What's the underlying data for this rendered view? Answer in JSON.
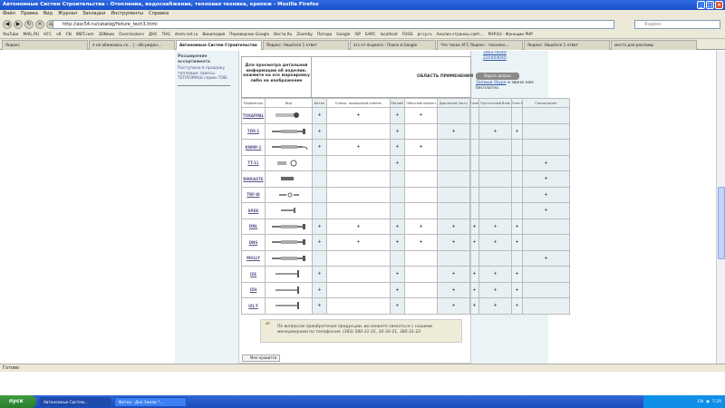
{
  "window": {
    "title": "Автономные Систем Строительства - Отопление, водоснабжение, тепловая техника, крепеж - Mozilla Firefox"
  },
  "menu": [
    "Файл",
    "Правка",
    "Вид",
    "Журнал",
    "Закладки",
    "Инструменты",
    "Справка"
  ],
  "address": {
    "url": "http://asc54.ru/catalog/fixture_tech3.html",
    "search_placeholder": "Яндекс"
  },
  "bookmarks": [
    "YouTube",
    "MAIL.RU",
    "НГС",
    "vK",
    "CN",
    "WBT.com",
    "3DNews",
    "Overclockers",
    "ДНС",
    "THG",
    "drom.net.ru",
    "Википедия",
    "Переводчик Google",
    "Вести.Ru",
    "Zoomby",
    "Погода",
    "Google",
    "ISP",
    "БАРС",
    "localhost",
    "FDGS",
    "pr-cy.ru",
    "Анализ страниц сайт...",
    "PHP.SU - Функции PHP"
  ],
  "tabs": [
    {
      "label": "Яндекс",
      "active": false
    },
    {
      "label": "я не обижаюсь ск... | - обсужден...",
      "active": false
    },
    {
      "label": "Автономные Систем Строительства",
      "active": true
    },
    {
      "label": "Яндекс: Нашёлся 1 ответ",
      "active": false
    },
    {
      "label": "агс от яндекса - Поиск в Google",
      "active": false
    },
    {
      "label": "Что такое АГС Яндекс - плохиен...",
      "active": false
    },
    {
      "label": "Яндекс: Нашёлся 1 ответ",
      "active": false
    },
    {
      "label": "место для рекламы",
      "active": false
    }
  ],
  "left": {
    "heading": "Расширение ассортимента",
    "text": "Поступили в продажу тепловые завесы ТЕПЛОМАШ серии ПЭВ."
  },
  "info": {
    "prompt": "Для просмотра детальной информации об изделии, нажмите на его маркировку либо на изображение",
    "area_label": "ОБЛАСТЬ ПРИМЕНЕНИЯ"
  },
  "right": {
    "phone1": "346276040",
    "phone2": "220404040",
    "button": "Задать вопрос",
    "note_link": "Запиши Skype",
    "note_rest": " и звони нам бесплатно."
  },
  "table": {
    "headers": [
      "Параметры",
      "Вид",
      "Бетон",
      "Спекш. природный камень",
      "Легкий бетон",
      "Обычный кирпич",
      "Дырчатый (пол.)",
      "Газобетон",
      "Пустотелый блок",
      "Гипс.бетон",
      "Гипсокартон"
    ],
    "rows": [
      {
        "name": "TOXAPPAL",
        "marks": [
          "+",
          "+",
          "+",
          "+",
          "",
          "",
          "",
          "",
          ""
        ],
        "icon": "screw-plug"
      },
      {
        "name": "TDX-1",
        "marks": [
          "+",
          "",
          "+",
          "",
          "+",
          "",
          "+",
          "+",
          ""
        ],
        "icon": "long-anchor"
      },
      {
        "name": "KNMP-1",
        "marks": [
          "+",
          "+",
          "+",
          "+",
          "",
          "",
          "",
          "",
          ""
        ],
        "icon": "hook-anchor"
      },
      {
        "name": "TT-11",
        "marks": [
          "",
          "",
          "+",
          "",
          "",
          "",
          "",
          "",
          "+"
        ],
        "icon": "short-plug"
      },
      {
        "name": "RIKKASTE",
        "marks": [
          "",
          "",
          "",
          "",
          "",
          "",
          "",
          "",
          "+"
        ],
        "icon": "small-plug"
      },
      {
        "name": "TRF-W",
        "marks": [
          "",
          "",
          "",
          "",
          "",
          "",
          "",
          "",
          "+"
        ],
        "icon": "wing-plug"
      },
      {
        "name": "SPEK",
        "marks": [
          "",
          "",
          "",
          "",
          "",
          "",
          "",
          "",
          "+"
        ],
        "icon": "spring-anchor"
      },
      {
        "name": "DNL",
        "marks": [
          "+",
          "+",
          "+",
          "+",
          "+",
          "+",
          "+",
          "+",
          ""
        ],
        "icon": "nail-anchor"
      },
      {
        "name": "DNS",
        "marks": [
          "+",
          "+",
          "+",
          "+",
          "+",
          "+",
          "+",
          "+",
          ""
        ],
        "icon": "screw-anchor"
      },
      {
        "name": "MOLLY",
        "marks": [
          "",
          "",
          "",
          "",
          "",
          "",
          "",
          "",
          "+"
        ],
        "icon": "molly-bolt"
      },
      {
        "name": "IZE",
        "marks": [
          "+",
          "",
          "+",
          "",
          "+",
          "+",
          "+",
          "+",
          ""
        ],
        "icon": "frame-plug"
      },
      {
        "name": "IZH",
        "marks": [
          "+",
          "",
          "+",
          "",
          "+",
          "+",
          "+",
          "+",
          ""
        ],
        "icon": "frame-plug-2"
      },
      {
        "name": "IZL-T",
        "marks": [
          "+",
          "",
          "+",
          "",
          "+",
          "+",
          "+",
          "+",
          ""
        ],
        "icon": "frame-plug-3"
      }
    ]
  },
  "contact": {
    "line1": "По вопросам приобретения продукции, вы можете связаться с нашими",
    "line2": "менеджерами по телефонам: (383) 380-31-21, 30-30-21, 380-31-22"
  },
  "like": {
    "label": "Мне нравится"
  },
  "status": {
    "text": "Готово"
  },
  "taskbar": {
    "start": "пуск",
    "items": [
      "Автономные Систем...",
      "Фотки - Дно Земли *..."
    ],
    "lang": "EN",
    "clock": "7:29"
  },
  "colors": {
    "sidebar": "#eaf3f6",
    "titlebar": "#2e6ae4",
    "taskbar": "#3168d5"
  }
}
